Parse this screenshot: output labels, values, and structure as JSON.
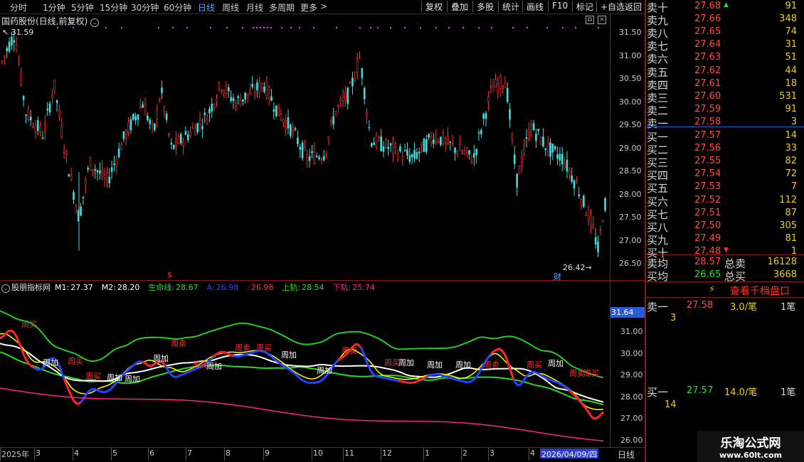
{
  "toolbar": {
    "periods": [
      "分时",
      "1分钟",
      "5分钟",
      "15分钟",
      "30分钟",
      "60分钟",
      "日线",
      "周线",
      "月线",
      "多周期",
      "更多"
    ],
    "active_period": "日线",
    "more_arrow": ">",
    "buttons": [
      "复权",
      "叠加",
      "多股",
      "统计",
      "画线",
      "F10",
      "标记",
      "+自选",
      "返回"
    ]
  },
  "main_chart": {
    "title": "国药股份(日线,前复权)",
    "high_label": "31.59",
    "low_label": "26.42",
    "cai_icon": "财",
    "dollar_marker": "$",
    "y_ticks": [
      "31.50",
      "31.00",
      "30.50",
      "30.00",
      "29.50",
      "29.00",
      "28.50",
      "28.00",
      "27.50",
      "27.00",
      "26.50"
    ]
  },
  "indicator": {
    "name": "股朋指标网",
    "items": [
      {
        "label": "M1:",
        "value": "27.37",
        "color": "#ffffff"
      },
      {
        "label": "M2:",
        "value": "28.20",
        "color": "#ffffff"
      },
      {
        "label": "生命线:",
        "value": "28.67",
        "color": "#22dd22"
      },
      {
        "label": "A:",
        "value": "26.98",
        "color": "#2244ff"
      },
      {
        "label": ":",
        "value": "26.98",
        "color": "#ff3030"
      },
      {
        "label": "上轨:",
        "value": "28.54",
        "color": "#22dd22"
      },
      {
        "label": "下轨:",
        "value": "25.74",
        "color": "#ff2080"
      }
    ],
    "current_value": "31.64",
    "y_ticks": [
      "31.00",
      "30.00",
      "29.00",
      "28.00",
      "27.00",
      "26.00"
    ],
    "signal_labels": [
      "周买",
      "周加",
      "周卖"
    ]
  },
  "x_axis": {
    "ticks": [
      "2025年",
      "3",
      "4",
      "5",
      "6",
      "7",
      "8",
      "9",
      "10",
      "11",
      "12",
      "1",
      "2",
      "3",
      "4"
    ],
    "cursor_date": "2026/04/09/四",
    "period_label": "日线"
  },
  "order_book": {
    "sells": [
      {
        "label": "卖十",
        "price": "27.68",
        "vol": "91"
      },
      {
        "label": "卖九",
        "price": "27.66",
        "vol": "348"
      },
      {
        "label": "卖八",
        "price": "27.65",
        "vol": "74"
      },
      {
        "label": "卖七",
        "price": "27.64",
        "vol": "31"
      },
      {
        "label": "卖六",
        "price": "27.63",
        "vol": "51"
      },
      {
        "label": "卖五",
        "price": "27.62",
        "vol": "44"
      },
      {
        "label": "卖四",
        "price": "27.61",
        "vol": "18"
      },
      {
        "label": "卖三",
        "price": "27.60",
        "vol": "531"
      },
      {
        "label": "卖二",
        "price": "27.59",
        "vol": "91"
      },
      {
        "label": "卖一",
        "price": "27.58",
        "vol": "3"
      }
    ],
    "buys": [
      {
        "label": "买一",
        "price": "27.57",
        "vol": "14"
      },
      {
        "label": "买二",
        "price": "27.56",
        "vol": "33"
      },
      {
        "label": "买三",
        "price": "27.55",
        "vol": "82"
      },
      {
        "label": "买四",
        "price": "27.54",
        "vol": "72"
      },
      {
        "label": "买五",
        "price": "27.53",
        "vol": "7"
      },
      {
        "label": "买六",
        "price": "27.52",
        "vol": "112"
      },
      {
        "label": "买七",
        "price": "27.51",
        "vol": "87"
      },
      {
        "label": "买八",
        "price": "27.50",
        "vol": "305"
      },
      {
        "label": "买九",
        "price": "27.49",
        "vol": "81"
      },
      {
        "label": "买十",
        "price": "27.48",
        "vol": "1"
      }
    ],
    "avg_sell_label": "卖均",
    "avg_sell": "28.57",
    "total_sell_label": "总卖",
    "total_sell": "16128",
    "avg_buy_label": "买均",
    "avg_buy": "26.65",
    "total_buy_label": "总买",
    "total_buy": "3668",
    "qiandang_label": "查看千档盘口",
    "detail_sell": {
      "label": "卖一",
      "price": "27.58",
      "amount": "3.0/笔",
      "count": "1笔",
      "sub": "3"
    },
    "detail_buy": {
      "label": "买一",
      "price": "27.57",
      "amount": "14.0/笔",
      "count": "1笔",
      "sub": "14"
    }
  },
  "watermark": {
    "line1": "乐淘公式网",
    "line2": "www.60lt.com"
  },
  "colors": {
    "up": "#ff3030",
    "down": "#44dddd",
    "grid": "#8b1a1a",
    "accent": "#5aa0ff"
  }
}
